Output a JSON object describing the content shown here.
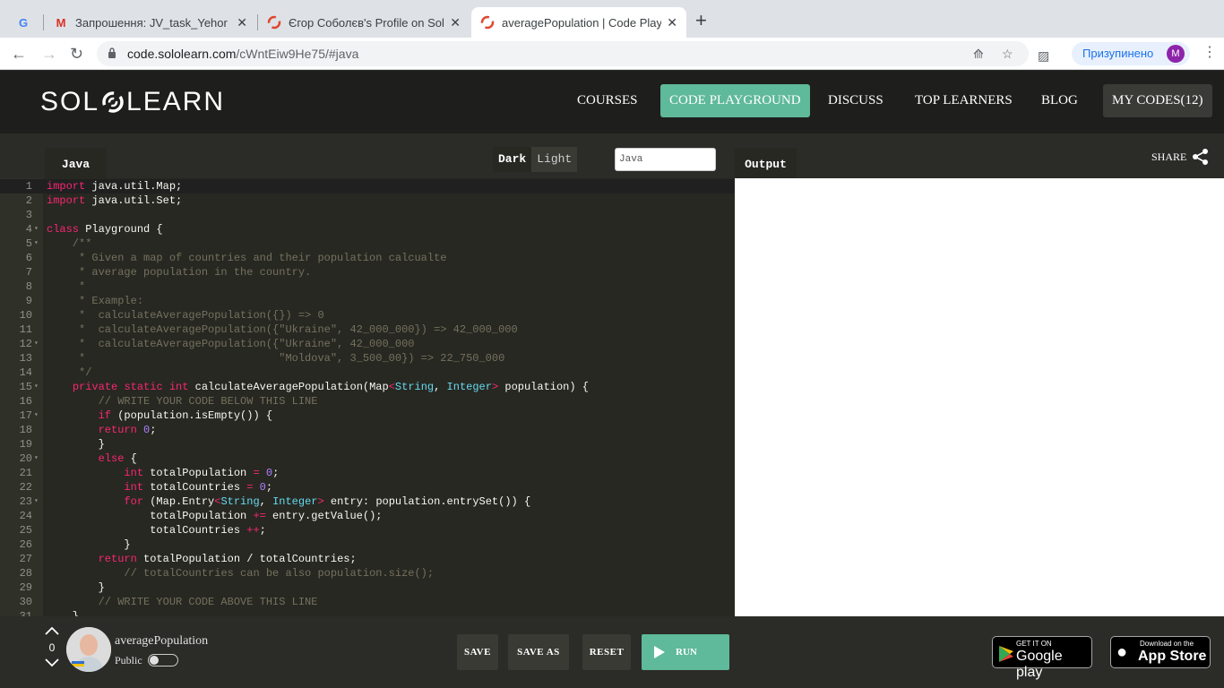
{
  "browser": {
    "tabs": [
      {
        "title": "Запрошення: JV_task_Yehor @",
        "favicon": "gmail-icon"
      },
      {
        "title": "Єгор Соболєв's Profile on Solo",
        "favicon": "sololearn-icon"
      },
      {
        "title": "averagePopulation | Code Playg",
        "favicon": "sololearn-icon"
      }
    ],
    "url_host": "code.sololearn.com",
    "url_path": "/cWntEiw9He75/#java",
    "profile_status": "Призупинено",
    "profile_initial": "M"
  },
  "site": {
    "logo_left": "SOL",
    "logo_right": "LEARN",
    "nav": {
      "courses": "COURSES",
      "playground": "CODE PLAYGROUND",
      "discuss": "DISCUSS",
      "top_learners": "TOP LEARNERS",
      "blog": "BLOG",
      "my_codes": "MY CODES(12)"
    }
  },
  "playground": {
    "lang_tab": "Java",
    "theme_dark": "Dark",
    "theme_light": "Light",
    "language_select": "Java",
    "output_tab": "Output",
    "share": "SHARE"
  },
  "code_lines": [
    "import java.util.Map;",
    "import java.util.Set;",
    "",
    "class Playground {",
    "    /**",
    "     * Given a map of countries and their population calcualte",
    "     * average population in the country.",
    "     *",
    "     * Example:",
    "     *  calculateAveragePopulation({}) => 0",
    "     *  calculateAveragePopulation({\"Ukraine\", 42_000_000}) => 42_000_000",
    "     *  calculateAveragePopulation({\"Ukraine\", 42_000_000",
    "     *                              \"Moldova\", 3_500_00}) => 22_750_000",
    "     */",
    "    private static int calculateAveragePopulation(Map<String, Integer> population) {",
    "        // WRITE YOUR CODE BELOW THIS LINE",
    "        if (population.isEmpty()) {",
    "        return 0;",
    "        }",
    "        else {",
    "            int totalPopulation = 0;",
    "            int totalCountries = 0;",
    "            for (Map.Entry<String, Integer> entry: population.entrySet()) {",
    "                totalPopulation += entry.getValue();",
    "                totalCountries ++;",
    "            }",
    "        return totalPopulation / totalCountries;",
    "            // totalCountries can be also population.size();",
    "        }",
    "        // WRITE YOUR CODE ABOVE THIS LINE",
    "    }"
  ],
  "fold_lines": [
    4,
    5,
    12,
    15,
    17,
    20,
    23
  ],
  "footer": {
    "votes": "0",
    "code_name": "averagePopulation",
    "visibility": "Public",
    "save": "SAVE",
    "save_as": "SAVE AS",
    "reset": "RESET",
    "run": "RUN",
    "google_small": "GET IT ON",
    "google_big": "Google play",
    "apple_small": "Download on the",
    "apple_big": "App Store"
  },
  "colors": {
    "accent": "#5fb99b",
    "editor_bg": "#272822"
  }
}
